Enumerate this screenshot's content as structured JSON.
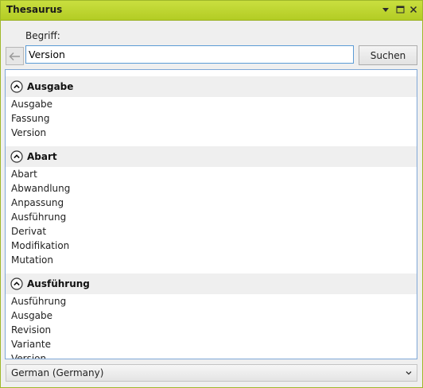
{
  "window": {
    "title": "Thesaurus",
    "menu_icon": "dropdown-triangle-icon",
    "maximize_icon": "maximize-icon",
    "close_icon": "close-x-icon"
  },
  "search": {
    "label": "Begriff:",
    "value": "Version",
    "button_label": "Suchen",
    "back_icon": "back-arrow-icon"
  },
  "groups": [
    {
      "title": "Ausgabe",
      "terms": [
        "Ausgabe",
        "Fassung",
        "Version"
      ]
    },
    {
      "title": "Abart",
      "terms": [
        "Abart",
        "Abwandlung",
        "Anpassung",
        "Ausführung",
        "Derivat",
        "Modifikation",
        "Mutation"
      ]
    },
    {
      "title": "Ausführung",
      "terms": [
        "Ausführung",
        "Ausgabe",
        "Revision",
        "Variante",
        "Version"
      ]
    }
  ],
  "language": {
    "selected": "German (Germany)"
  },
  "colors": {
    "titlebar": "#b3cc24",
    "input_border": "#5b9bd5",
    "group_header_bg": "#efefef"
  }
}
